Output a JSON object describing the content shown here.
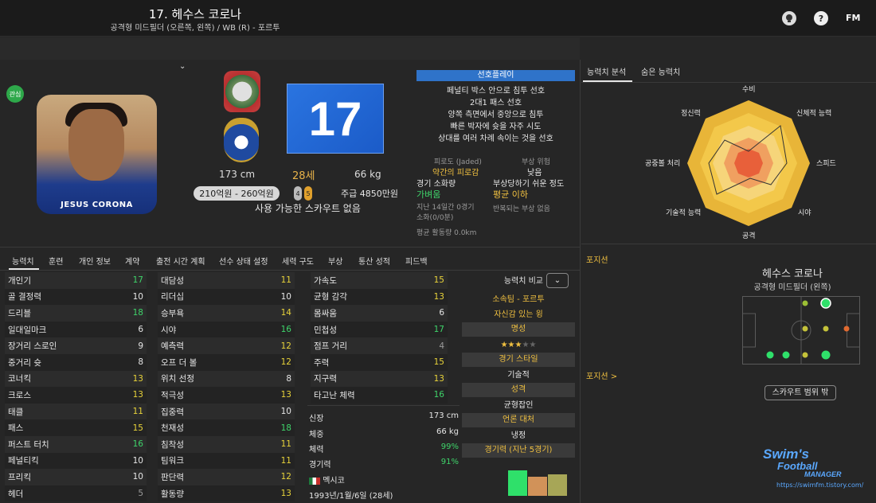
{
  "header": {
    "title": "17. 헤수스 코로나",
    "subtitle": "공격형 미드필더 (오른쪽, 왼쪽) / WB (R) - 포르투",
    "help_label": "?",
    "fm_label": "FM"
  },
  "profile": {
    "badge_label": "관심",
    "shirt_name": "JESUS CORONA",
    "shirt_number": "17",
    "height": "173 cm",
    "age": "28세",
    "weight": "66 kg",
    "value": "210억원 - 260억원",
    "dot_a": "4",
    "dot_b": "5",
    "wage": "주급 4850만원",
    "scout_note": "사용 가능한 스카우트 없음"
  },
  "preferred_moves": {
    "title": "선호플레이",
    "items": [
      "페널티 박스 안으로 침투 선호",
      "2대1 패스 선호",
      "양쪽 측면에서 중앙으로 침투",
      "빠른 박자에 슛을 자주 시도",
      "상대를 여러 차례 속이는 것을 선호"
    ]
  },
  "condition": {
    "fatigue_label": "피로도 (Jaded)",
    "fatigue_value": "약간의 피로감",
    "injury_risk_label": "부상 위험",
    "injury_risk_value": "낮음",
    "match_load_label": "경기 소화량",
    "match_load_value": "가벼움",
    "injury_prone_label": "부상당하기 쉬운 정도",
    "injury_prone_value": "평균 이하",
    "match_load_note": "지난 14일간 0경기 소화(0/0분)",
    "injury_note": "반복되는 부상 없음",
    "avg_distance": "평균 활동량 0.0km"
  },
  "right_tabs": {
    "active": "능력치 분석",
    "other": "숨은 능력치"
  },
  "radar": {
    "labels": [
      "수비",
      "신체적 능력",
      "스피드",
      "시야",
      "공격",
      "기술적 능력",
      "공중볼 처리",
      "정신력"
    ]
  },
  "bottom_tabs": [
    "능력치",
    "훈련",
    "개인 정보",
    "계약",
    "출전 시간 계획",
    "선수 상태 설정",
    "세력 구도",
    "부상",
    "통산 성적",
    "피드백"
  ],
  "technical": [
    {
      "name": "개인기",
      "value": "17",
      "color": "green"
    },
    {
      "name": "골 결정력",
      "value": "10",
      "color": "white"
    },
    {
      "name": "드리블",
      "value": "18",
      "color": "green"
    },
    {
      "name": "일대일마크",
      "value": "6",
      "color": "white"
    },
    {
      "name": "장거리 스로인",
      "value": "9",
      "color": "white"
    },
    {
      "name": "중거리 슛",
      "value": "8",
      "color": "white"
    },
    {
      "name": "코너킥",
      "value": "13",
      "color": "yellow"
    },
    {
      "name": "크로스",
      "value": "13",
      "color": "yellow"
    },
    {
      "name": "태클",
      "value": "11",
      "color": "yellow"
    },
    {
      "name": "패스",
      "value": "15",
      "color": "yellow"
    },
    {
      "name": "퍼스트 터치",
      "value": "16",
      "color": "green"
    },
    {
      "name": "페널티킥",
      "value": "10",
      "color": "white"
    },
    {
      "name": "프리킥",
      "value": "10",
      "color": "white"
    },
    {
      "name": "헤더",
      "value": "5",
      "color": "gray"
    }
  ],
  "mental": [
    {
      "name": "대담성",
      "value": "11",
      "color": "yellow"
    },
    {
      "name": "리더십",
      "value": "10",
      "color": "white"
    },
    {
      "name": "승부욕",
      "value": "14",
      "color": "yellow"
    },
    {
      "name": "시야",
      "value": "16",
      "color": "green"
    },
    {
      "name": "예측력",
      "value": "12",
      "color": "yellow"
    },
    {
      "name": "오프 더 볼",
      "value": "12",
      "color": "yellow"
    },
    {
      "name": "위치 선정",
      "value": "8",
      "color": "white"
    },
    {
      "name": "적극성",
      "value": "13",
      "color": "yellow"
    },
    {
      "name": "집중력",
      "value": "10",
      "color": "white"
    },
    {
      "name": "천재성",
      "value": "18",
      "color": "green"
    },
    {
      "name": "침착성",
      "value": "11",
      "color": "yellow"
    },
    {
      "name": "팀워크",
      "value": "11",
      "color": "yellow"
    },
    {
      "name": "판단력",
      "value": "12",
      "color": "yellow"
    },
    {
      "name": "활동량",
      "value": "13",
      "color": "yellow"
    }
  ],
  "physical": [
    {
      "name": "가속도",
      "value": "15",
      "color": "yellow"
    },
    {
      "name": "균형 감각",
      "value": "13",
      "color": "yellow"
    },
    {
      "name": "몸싸움",
      "value": "6",
      "color": "white"
    },
    {
      "name": "민첩성",
      "value": "17",
      "color": "green"
    },
    {
      "name": "점프 거리",
      "value": "4",
      "color": "gray"
    },
    {
      "name": "주력",
      "value": "15",
      "color": "yellow"
    },
    {
      "name": "지구력",
      "value": "13",
      "color": "yellow"
    },
    {
      "name": "타고난 체력",
      "value": "16",
      "color": "green"
    }
  ],
  "info": {
    "height_label": "신장",
    "height_value": "173 cm",
    "weight_label": "체중",
    "weight_value": "66 kg",
    "stamina_label": "체력",
    "stamina_value": "99%",
    "sharpness_label": "경기력",
    "sharpness_value": "91%",
    "nation": "멕시코",
    "dob": "1993년/1월/6일 (28세)"
  },
  "compare": {
    "dropdown_label": "능력치 비교",
    "club_tag": "소속팀 - 포르투",
    "personality": "자신감 있는 윙",
    "fame_label": "명성",
    "fame_stars": 3,
    "fame_max": 5,
    "style_label": "경기 스타일",
    "style_value": "기술적",
    "personality_label": "성격",
    "personality_value": "균형잡인",
    "media_label": "언론 대처",
    "media_value": "냉정",
    "form_label": "경기력 (지난 5경기)",
    "form_bars": [
      0.95,
      0.72,
      0.78
    ],
    "colors": {
      "bar1": "#2fe06a",
      "bar2": "#d19259",
      "bar3": "#a7a657"
    }
  },
  "position": {
    "section_label": "포지션",
    "section_label2": "포지션 >",
    "player_name": "헤수스 코로나",
    "role": "공격형 미드필더 (왼쪽)",
    "scout_button": "스카우트 범위 밖"
  },
  "watermark": {
    "line1": "Swim's",
    "line2": "Football",
    "line3": "MANAGER",
    "url": "https://swimfm.tistory.com/"
  }
}
